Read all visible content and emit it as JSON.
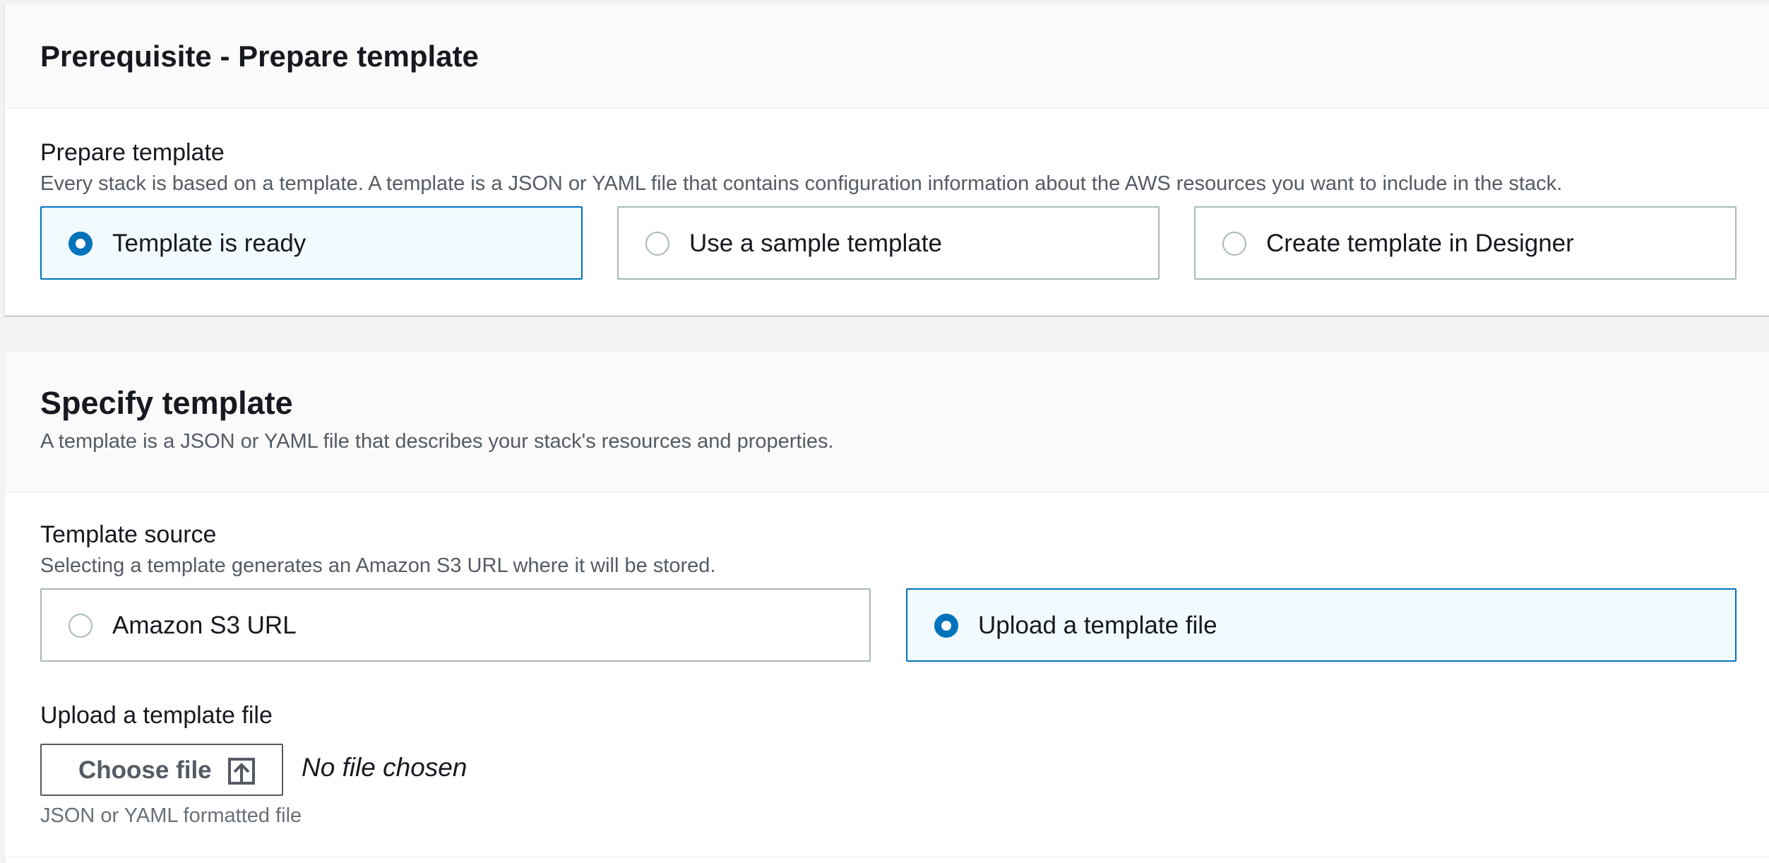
{
  "prepare_section": {
    "title": "Prerequisite - Prepare template",
    "field_label": "Prepare template",
    "field_description": "Every stack is based on a template. A template is a JSON or YAML file that contains configuration information about the AWS resources you want to include in the stack.",
    "options": [
      {
        "label": "Template is ready",
        "selected": true
      },
      {
        "label": "Use a sample template",
        "selected": false
      },
      {
        "label": "Create template in Designer",
        "selected": false
      }
    ]
  },
  "specify_section": {
    "title": "Specify template",
    "description": "A template is a JSON or YAML file that describes your stack's resources and properties.",
    "source_label": "Template source",
    "source_description": "Selecting a template generates an Amazon S3 URL where it will be stored.",
    "source_options": [
      {
        "label": "Amazon S3 URL",
        "selected": false
      },
      {
        "label": "Upload a template file",
        "selected": true
      }
    ],
    "upload_label": "Upload a template file",
    "choose_file_label": "Choose file",
    "choose_file_icon": "upload-icon",
    "no_file_text": "No file chosen",
    "constraint_text": "JSON or YAML formatted file"
  },
  "colors": {
    "accent": "#0073bb",
    "selected_bg": "#f1faff",
    "border": "#aab7b8",
    "text": "#16191f",
    "secondary_text": "#545b64"
  }
}
